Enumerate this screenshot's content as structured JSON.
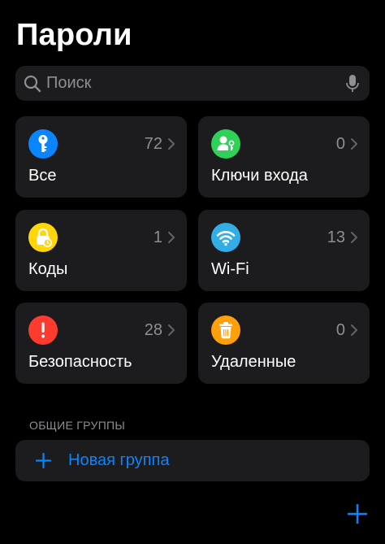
{
  "header": {
    "title": "Пароли"
  },
  "search": {
    "placeholder": "Поиск",
    "value": ""
  },
  "categories": [
    {
      "label": "Все",
      "count": "72",
      "icon": "key-icon",
      "color": "#0a84ff"
    },
    {
      "label": "Ключи входа",
      "count": "0",
      "icon": "passkey-person-icon",
      "color": "#30d158"
    },
    {
      "label": "Коды",
      "count": "1",
      "icon": "lock-clock-icon",
      "color": "#ffd60a"
    },
    {
      "label": "Wi-Fi",
      "count": "13",
      "icon": "wifi-icon",
      "color": "#32ade6"
    },
    {
      "label": "Безопасность",
      "count": "28",
      "icon": "exclamation-icon",
      "color": "#ff3b30"
    },
    {
      "label": "Удаленные",
      "count": "0",
      "icon": "trash-icon",
      "color": "#ff9f0a"
    }
  ],
  "shared_groups": {
    "header": "ОБЩИЕ ГРУППЫ",
    "new_group_label": "Новая группа"
  },
  "colors": {
    "background": "#000000",
    "card": "#1c1c1e",
    "accent": "#0a84ff",
    "secondary_text": "#8e8e93"
  }
}
